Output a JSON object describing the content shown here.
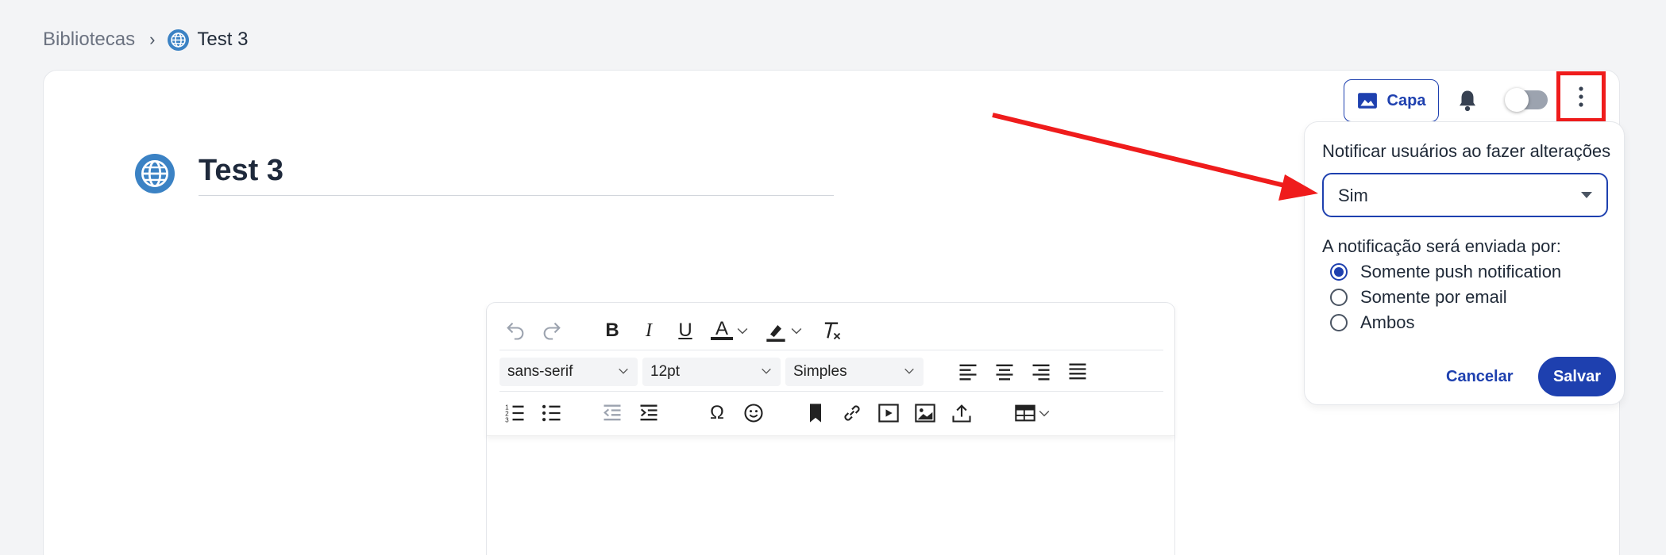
{
  "breadcrumb": {
    "root": "Bibliotecas",
    "separator": "›",
    "current": "Test 3"
  },
  "header": {
    "cover_label": "Capa"
  },
  "document": {
    "title": "Test 3"
  },
  "editor": {
    "font_family": "sans-serif",
    "font_size": "12pt",
    "line_spacing": "Simples",
    "icons_row1": [
      "undo-icon",
      "redo-icon",
      "bold-icon",
      "italic-icon",
      "underline-icon",
      "text-color-icon",
      "highlight-icon",
      "clear-format-icon"
    ],
    "icons_row3": [
      "numbered-list-icon",
      "bullet-list-icon",
      "outdent-icon",
      "indent-icon",
      "special-char-icon",
      "emoji-icon",
      "bookmark-icon",
      "link-icon",
      "video-icon",
      "image-icon",
      "upload-icon",
      "table-icon"
    ],
    "glyphs": {
      "bold": "B",
      "italic": "I",
      "underline": "U",
      "text_color": "A",
      "omega": "Ω"
    }
  },
  "notify_panel": {
    "label": "Notificar usuários ao fazer alterações",
    "selected": "Sim",
    "send_label": "A notificação será enviada por:",
    "options": [
      {
        "label": "Somente push notification",
        "checked": true
      },
      {
        "label": "Somente por email",
        "checked": false
      },
      {
        "label": "Ambos",
        "checked": false
      }
    ],
    "cancel_label": "Cancelar",
    "save_label": "Salvar"
  },
  "colors": {
    "primary": "#1e40af",
    "annotation_red": "#ef1c1c",
    "globe": "#3b82c4"
  }
}
